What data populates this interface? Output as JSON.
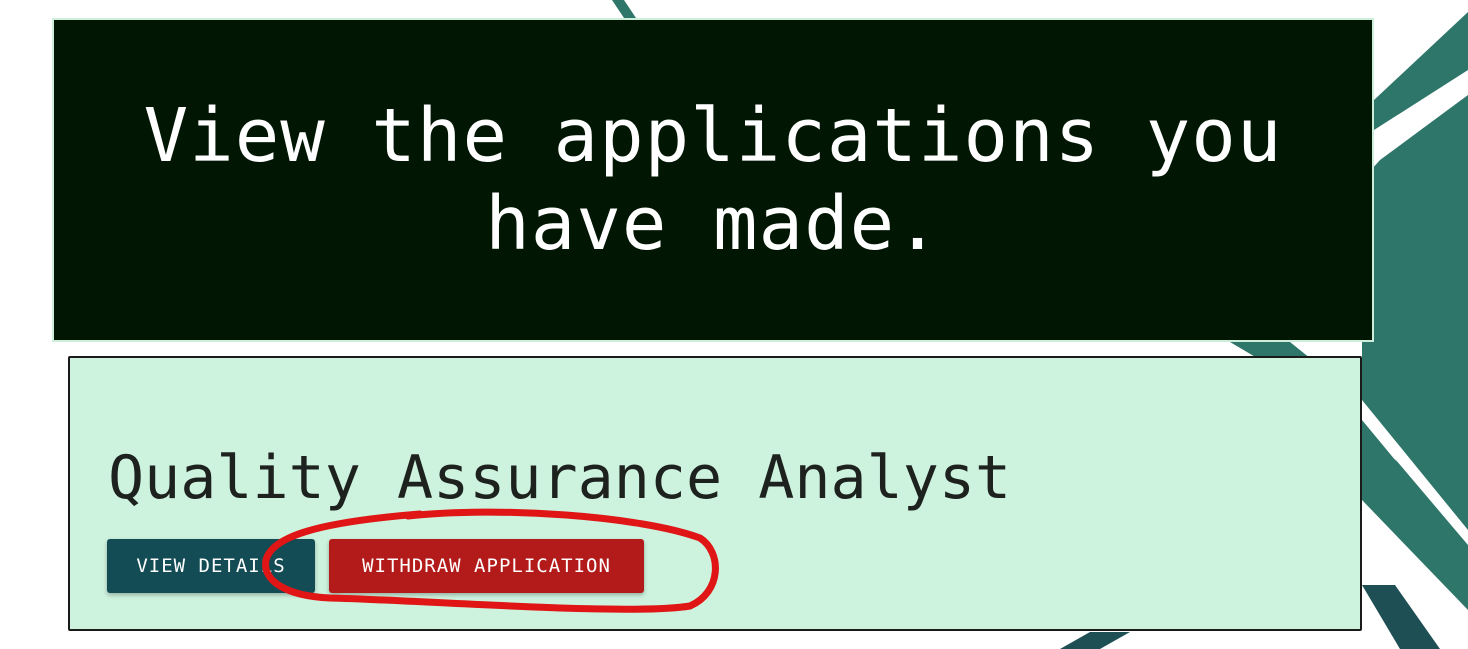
{
  "colors": {
    "page_background": "#ffffff",
    "background_stripes": "#2e766a",
    "banner_background": "#021604",
    "banner_text": "#ffffff",
    "card_background": "#cdf2de",
    "card_border": "#1a1a1a",
    "view_details_button": "#134c55",
    "withdraw_button": "#b31b1b",
    "annotation_circle": "#e01515"
  },
  "banner": {
    "title": "View the applications you have made."
  },
  "applications": [
    {
      "job_title": "Quality Assurance Analyst",
      "view_details_label": "View Details",
      "withdraw_label": "Withdraw Application"
    }
  ],
  "annotation": {
    "shape": "hand-drawn circle",
    "target": "withdraw-application-button"
  }
}
